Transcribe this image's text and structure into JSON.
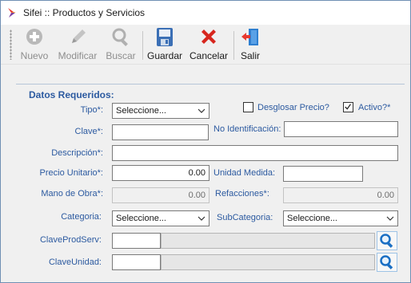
{
  "window": {
    "title": "Sifei :: Productos y Servicios"
  },
  "toolbar": {
    "nuevo": "Nuevo",
    "modificar": "Modificar",
    "buscar": "Buscar",
    "guardar": "Guardar",
    "cancelar": "Cancelar",
    "salir": "Salir"
  },
  "form": {
    "section_title": "Datos Requeridos:",
    "tipo_label": "Tipo*:",
    "tipo_value": "Seleccione...",
    "desglosar_label": "Desglosar Precio?",
    "activo_label": "Activo?*",
    "desglosar_checked": false,
    "activo_checked": true,
    "clave_label": "Clave*:",
    "clave_value": "",
    "noident_label": "No Identificación:",
    "noident_value": "",
    "descripcion_label": "Descripción*:",
    "descripcion_value": "",
    "precio_label": "Precio Unitario*:",
    "precio_value": "0.00",
    "unidad_label": "Unidad Medida:",
    "unidad_value": "",
    "mano_label": "Mano de Obra*:",
    "mano_value": "0.00",
    "refacciones_label": "Refacciones*:",
    "refacciones_value": "0.00",
    "categoria_label": "Categoria:",
    "categoria_value": "Seleccione...",
    "subcategoria_label": "SubCategoria:",
    "subcategoria_value": "Seleccione...",
    "claveprodserv_label": "ClaveProdServ:",
    "claveunidad_label": "ClaveUnidad:"
  },
  "colors": {
    "label_blue": "#2c5aa0",
    "accent": "#0078d7",
    "cancel_red": "#d7261e"
  }
}
